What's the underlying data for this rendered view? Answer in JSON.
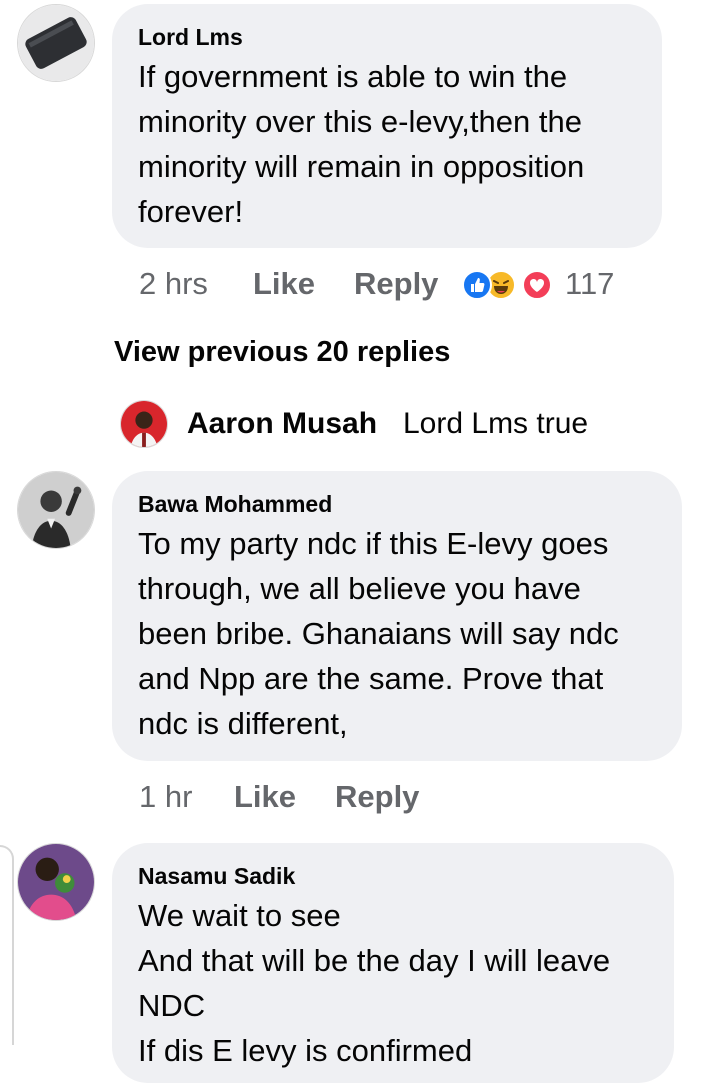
{
  "comments": [
    {
      "author": "Lord Lms",
      "text": "If government is able to win the\nminority over this e-levy,then the\nminority will remain in opposition\nforever!",
      "time": "2 hrs",
      "like_label": "Like",
      "reply_label": "Reply",
      "reaction_count": "117",
      "reactions": [
        "like-icon",
        "haha-icon",
        "love-icon"
      ]
    },
    {
      "author": "Bawa Mohammed",
      "text": "To my party ndc if this E-levy goes\nthrough, we all believe you have\nbeen bribe. Ghanaians will say ndc\nand Npp are the same. Prove that\nndc is different,",
      "time": "1 hr",
      "like_label": "Like",
      "reply_label": "Reply"
    },
    {
      "author": "Nasamu Sadik",
      "text": "We wait to see\nAnd that will be the day I will leave\nNDC\nIf dis E levy is confirmed"
    }
  ],
  "view_previous": "View previous 20 replies",
  "latest_reply": {
    "author": "Aaron Musah",
    "text": "Lord Lms true"
  },
  "colors": {
    "bubble": "#eff0f3",
    "muted": "#65676b",
    "like_blue": "#1877f2",
    "haha_yellow": "#f7b928",
    "love_red": "#f33e58"
  }
}
